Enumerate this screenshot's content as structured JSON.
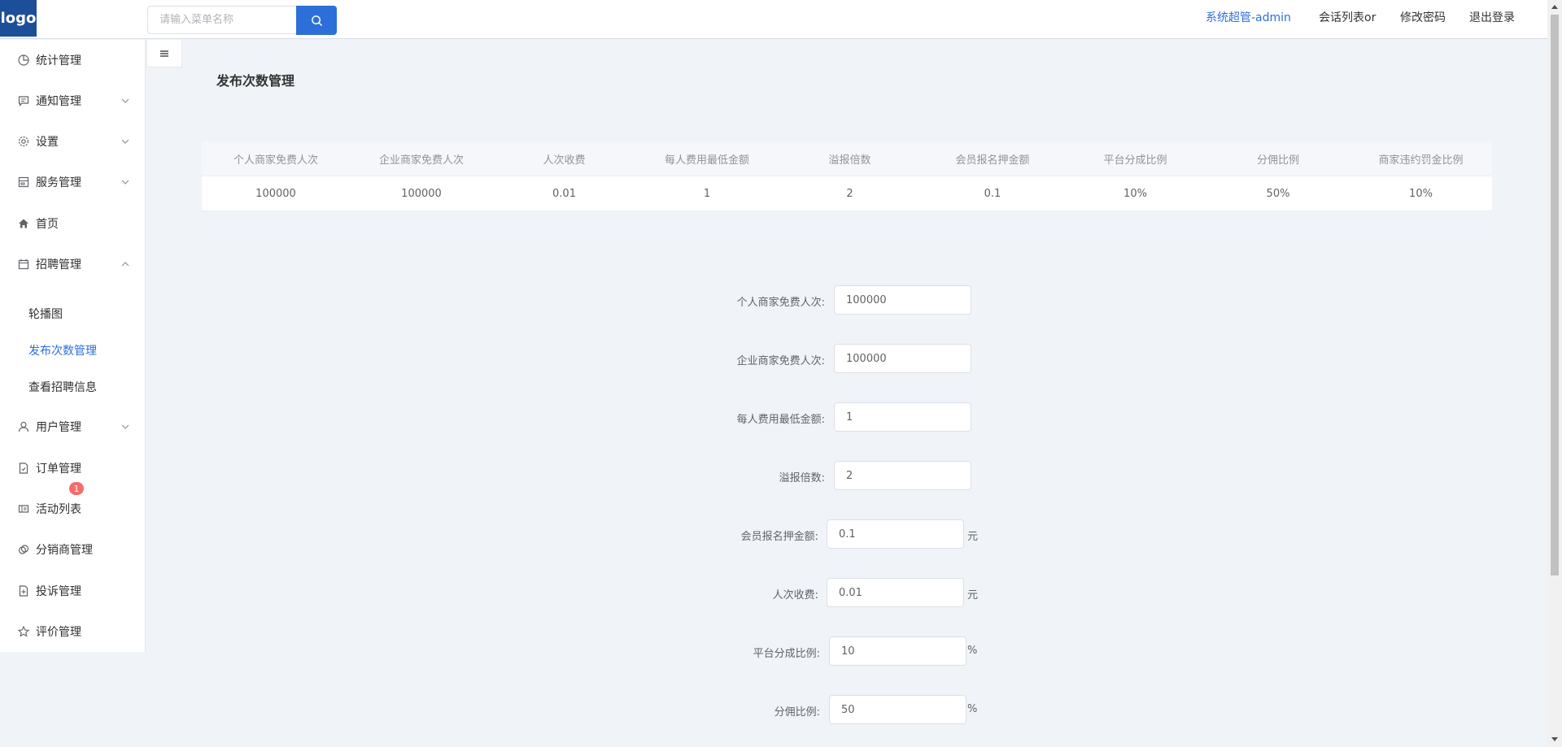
{
  "header": {
    "logo": "logo",
    "search_placeholder": "请输入菜单名称",
    "admin": "系统超管-admin",
    "chat_list": "会话列表or",
    "change_password": "修改密码",
    "logout": "退出登录"
  },
  "sidebar": {
    "items": [
      {
        "label": "统计管理",
        "icon": "pie-chart-icon"
      },
      {
        "label": "通知管理",
        "icon": "chat-icon"
      },
      {
        "label": "设置",
        "icon": "gear-icon"
      },
      {
        "label": "服务管理",
        "icon": "server-icon"
      },
      {
        "label": "首页",
        "icon": "home-icon"
      },
      {
        "label": "招聘管理",
        "icon": "calendar-icon"
      },
      {
        "label": "用户管理",
        "icon": "user-icon"
      },
      {
        "label": "订单管理",
        "icon": "document-icon"
      },
      {
        "label": "活动列表",
        "icon": "ticket-icon"
      },
      {
        "label": "分销商管理",
        "icon": "copy-icon"
      },
      {
        "label": "投诉管理",
        "icon": "document-add-icon"
      },
      {
        "label": "评价管理",
        "icon": "star-icon"
      }
    ],
    "submenu": [
      "轮播图",
      "发布次数管理",
      "查看招聘信息"
    ],
    "badge": "1"
  },
  "main": {
    "title": "发布次数管理",
    "table": {
      "headers": [
        "个人商家免费人次",
        "企业商家免费人次",
        "人次收费",
        "每人费用最低金额",
        "溢报倍数",
        "会员报名押金额",
        "平台分成比例",
        "分佣比例",
        "商家违约罚金比例"
      ],
      "row": [
        "100000",
        "100000",
        "0.01",
        "1",
        "2",
        "0.1",
        "10%",
        "50%",
        "10%"
      ]
    },
    "form": [
      {
        "label": "个人商家免费人次:",
        "value": "100000",
        "unit": ""
      },
      {
        "label": "企业商家免费人次:",
        "value": "100000",
        "unit": ""
      },
      {
        "label": "每人费用最低金额:",
        "value": "1",
        "unit": ""
      },
      {
        "label": "溢报倍数:",
        "value": "2",
        "unit": ""
      },
      {
        "label": "会员报名押金额:",
        "value": "0.1",
        "unit": "元"
      },
      {
        "label": "人次收费:",
        "value": "0.01",
        "unit": "元"
      },
      {
        "label": "平台分成比例:",
        "value": "10",
        "unit": "%"
      },
      {
        "label": "分佣比例:",
        "value": "50",
        "unit": "%"
      }
    ]
  },
  "colors": {
    "accent": "#2d6fd8",
    "logo_bg": "#1c4e99",
    "badge": "#f56c6c",
    "page_bg": "#f0f4f9"
  }
}
